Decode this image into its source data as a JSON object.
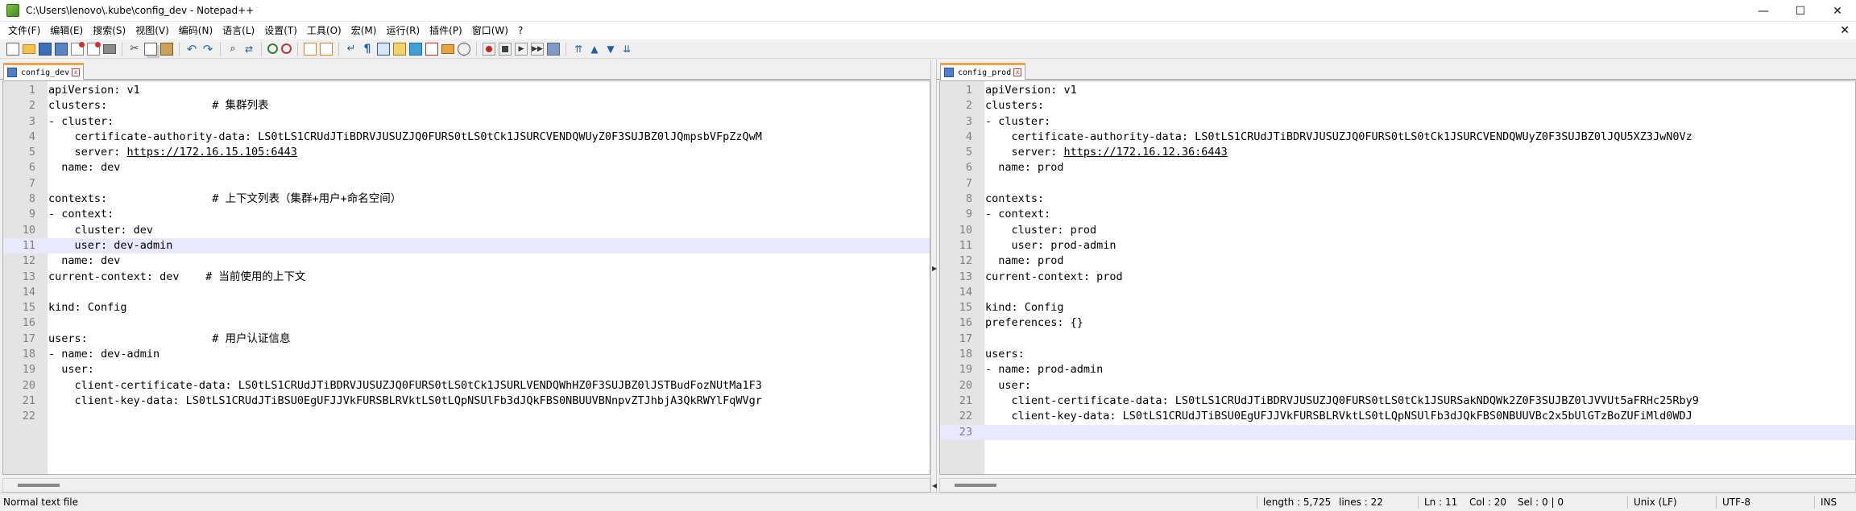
{
  "window": {
    "title": "C:\\Users\\lenovo\\.kube\\config_dev - Notepad++",
    "minimize": "—",
    "maximize": "☐",
    "close": "✕"
  },
  "menu": {
    "items": [
      "文件(F)",
      "编辑(E)",
      "搜索(S)",
      "视图(V)",
      "编码(N)",
      "语言(L)",
      "设置(T)",
      "工具(O)",
      "宏(M)",
      "运行(R)",
      "插件(P)",
      "窗口(W)",
      "?"
    ],
    "close_doc": "✕"
  },
  "left": {
    "tab": "config_dev",
    "lines": [
      "apiVersion: v1",
      "clusters:                # 集群列表",
      "- cluster:",
      "    certificate-authority-data: LS0tLS1CRUdJTiBDRVJUSUZJQ0FURS0tLS0tCk1JSURCVENDQWUyZ0F3SUJBZ0lJQmpsbVFpZzQwM",
      "    server: https://172.16.15.105:6443",
      "  name: dev",
      "",
      "contexts:                # 上下文列表（集群+用户+命名空间）",
      "- context:",
      "    cluster: dev",
      "    user: dev-admin",
      "  name: dev",
      "current-context: dev    # 当前使用的上下文",
      "",
      "kind: Config",
      "",
      "users:                   # 用户认证信息",
      "- name: dev-admin",
      "  user:",
      "    client-certificate-data: LS0tLS1CRUdJTiBDRVJUSUZJQ0FURS0tLS0tCk1JSURLVENDQWhHZ0F3SUJBZ0lJSTBudFozNUtMa1F3",
      "    client-key-data: LS0tLS1CRUdJTiBSU0EgUFJJVkFURSBLRVktLS0tLQpNSUlFb3dJQkFBS0NBUUVBNnpvZTJhbjA3QkRWYlFqWVgr",
      ""
    ]
  },
  "right": {
    "tab": "config_prod",
    "lines": [
      "apiVersion: v1",
      "clusters:",
      "- cluster:",
      "    certificate-authority-data: LS0tLS1CRUdJTiBDRVJUSUZJQ0FURS0tLS0tCk1JSURCVENDQWUyZ0F3SUJBZ0lJQU5XZ3JwN0Vz",
      "    server: https://172.16.12.36:6443",
      "  name: prod",
      "",
      "contexts:",
      "- context:",
      "    cluster: prod",
      "    user: prod-admin",
      "  name: prod",
      "current-context: prod",
      "",
      "kind: Config",
      "preferences: {}",
      "",
      "users:",
      "- name: prod-admin",
      "  user:",
      "    client-certificate-data: LS0tLS1CRUdJTiBDRVJUSUZJQ0FURS0tLS0tCk1JSURSakNDQWk2Z0F3SUJBZ0lJVVUt5aFRHc25Rby9",
      "    client-key-data: LS0tLS1CRUdJTiBSU0EgUFJJVkFURSBLRVktLS0tLQpNSUlFb3dJQkFBS0NBUUVBc2x5bUlGTzBoZUFiMld0WDJ",
      ""
    ]
  },
  "status": {
    "file_type": "Normal text file",
    "length": "length : 5,725",
    "lines": "lines : 22",
    "ln": "Ln : 11",
    "col": "Col : 20",
    "sel": "Sel : 0 | 0",
    "eol": "Unix (LF)",
    "encoding": "UTF-8",
    "mode": "INS"
  }
}
